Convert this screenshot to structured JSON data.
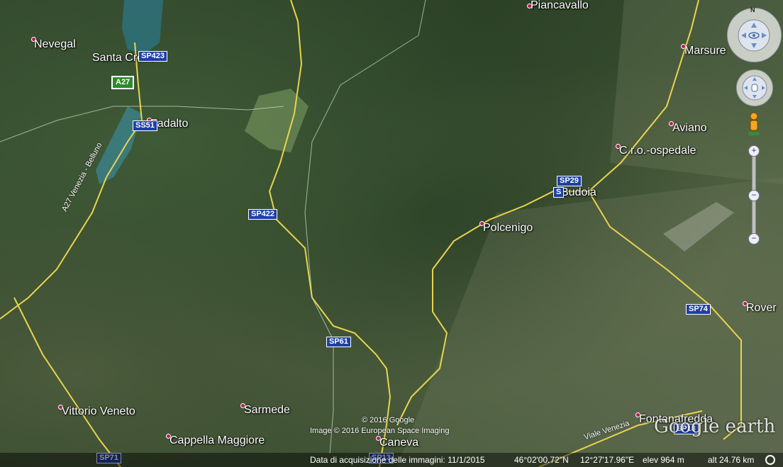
{
  "places": [
    {
      "name": "Piancavallo"
    },
    {
      "name": "Nevegal"
    },
    {
      "name": "Santa Croce"
    },
    {
      "name": "Marsure"
    },
    {
      "name": "Fadalto"
    },
    {
      "name": "Aviano"
    },
    {
      "name": "C.r.o.-ospedale"
    },
    {
      "name": "Budoia"
    },
    {
      "name": "Polcenigo"
    },
    {
      "name": "Rover"
    },
    {
      "name": "Vittorio Veneto"
    },
    {
      "name": "Sarmede"
    },
    {
      "name": "Cappella Maggiore"
    },
    {
      "name": "Caneva"
    },
    {
      "name": "Fontanafredda"
    }
  ],
  "roads": {
    "a27": "A27",
    "sp423": "SP423",
    "ss51": "SS51",
    "sp422": "SP422",
    "sp29": "SP29",
    "s_small": "S",
    "sp74": "SP74",
    "sp61": "SP61",
    "sp71": "SP71",
    "sp13": "SP13",
    "sp13_2": "SP13",
    "a27_label": "A27 Venezia - Belluno",
    "viale_venezia": "Viale Venezia"
  },
  "copyright": {
    "google": "© 2016 Google",
    "imagery": "Image © 2016 European Space Imaging"
  },
  "status": {
    "acquisition": "Data di acquisizione delle immagini: 11/1/2015",
    "lat": "46°02'00.72\"N",
    "lon": "12°27'17.96\"E",
    "elev": "elev   964 m",
    "alt": "alt  24.76 km"
  },
  "controls": {
    "north": "N",
    "zoom_in": "+",
    "zoom_out": "−"
  },
  "logo": "Google earth",
  "colors": {
    "road": "#e8d44d",
    "pin": "#c2185b",
    "shield": "#1f3fa8"
  }
}
